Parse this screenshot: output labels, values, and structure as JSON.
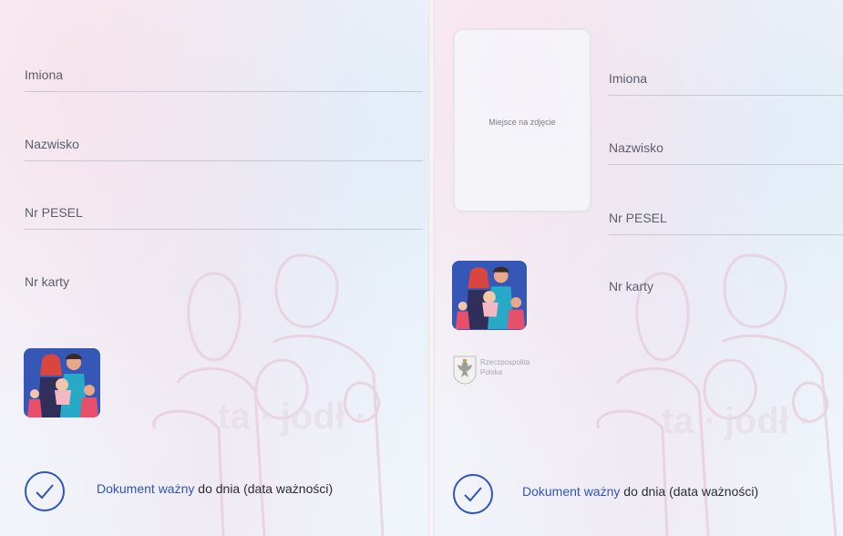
{
  "cards": {
    "left": {
      "fields": [
        {
          "label": "Imiona"
        },
        {
          "label": "Nazwisko"
        },
        {
          "label": "Nr PESEL"
        },
        {
          "label": "Nr karty"
        }
      ],
      "validity": {
        "highlight": "Dokument ważny",
        "rest": "do dnia (data ważności)"
      }
    },
    "right": {
      "photo_placeholder": "Miejsce na zdjęcie",
      "fields": [
        {
          "label": "Imiona"
        },
        {
          "label": "Nazwisko"
        },
        {
          "label": "Nr PESEL"
        },
        {
          "label": "Nr karty"
        }
      ],
      "emblem_text": {
        "line1": "Rzeczpospolita",
        "line2": "Polska"
      },
      "validity": {
        "highlight": "Dokument ważny",
        "rest": "do dnia (data ważności)"
      }
    }
  },
  "icons": {
    "family": "family-icon",
    "emblem": "polish-eagle-emblem-icon",
    "check": "checkmark-circle-icon"
  },
  "colors": {
    "accent": "#2f55b8",
    "icon_background": "#3557b6",
    "label_text": "#5a5e6b",
    "divider": "#c9c9d3"
  }
}
